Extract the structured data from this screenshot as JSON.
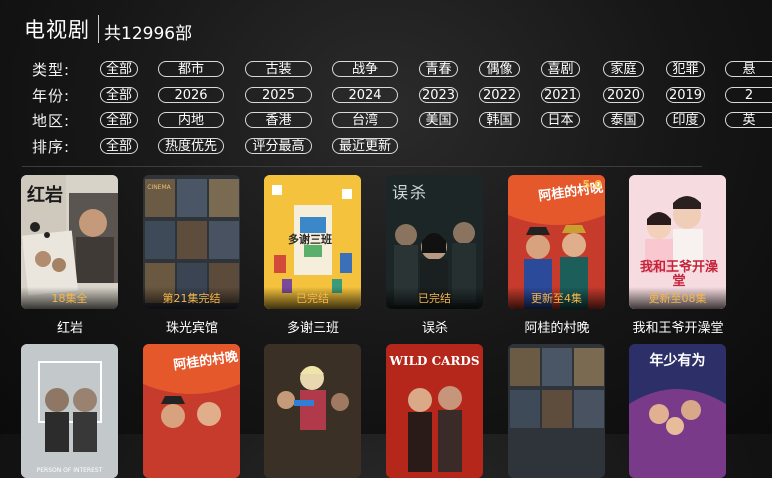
{
  "header": {
    "title": "电视剧",
    "count": "共12996部"
  },
  "filters": [
    {
      "label": "类型:",
      "chips": [
        "全部",
        "都市",
        "古装",
        "战争",
        "青春",
        "偶像",
        "喜剧",
        "家庭",
        "犯罪",
        "悬"
      ]
    },
    {
      "label": "年份:",
      "chips": [
        "全部",
        "2026",
        "2025",
        "2024",
        "2023",
        "2022",
        "2021",
        "2020",
        "2019",
        "2"
      ]
    },
    {
      "label": "地区:",
      "chips": [
        "全部",
        "内地",
        "香港",
        "台湾",
        "美国",
        "韩国",
        "日本",
        "泰国",
        "印度",
        "英"
      ]
    },
    {
      "label": "排序:",
      "chips": [
        "全部",
        "热度优先",
        "评分最高",
        "最近更新"
      ]
    }
  ],
  "row1": [
    {
      "title": "红岩",
      "badge": "18集全",
      "poster_text": "红岩"
    },
    {
      "title": "珠光宾馆",
      "badge": "第21集完结",
      "poster_text": ""
    },
    {
      "title": "多谢三班",
      "badge": "已完结",
      "poster_text": "多谢三班"
    },
    {
      "title": "误杀",
      "badge": "已完结",
      "poster_text": "误杀"
    },
    {
      "title": "阿桂的村晚",
      "badge": "更新至4集",
      "poster_text": "阿桂的村晚",
      "rating": "5.0"
    },
    {
      "title": "我和王爷开澡堂",
      "badge": "更新至08集",
      "poster_text": "我和王爷开澡堂"
    }
  ],
  "row2": [
    {
      "title": "",
      "poster_text": "PERSON OF INTEREST"
    },
    {
      "title": "",
      "poster_text": "阿桂的村晚"
    },
    {
      "title": "",
      "poster_text": ""
    },
    {
      "title": "",
      "poster_text": "WILD CARDS"
    },
    {
      "title": "",
      "poster_text": ""
    },
    {
      "title": "",
      "poster_text": "年少有为"
    }
  ]
}
